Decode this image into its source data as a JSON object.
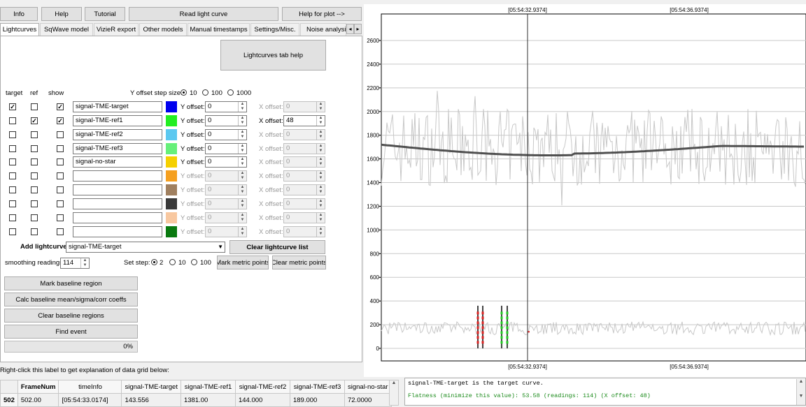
{
  "toolbar": {
    "info": "Info",
    "help": "Help",
    "tutorial": "Tutorial",
    "read_light_curve": "Read light curve",
    "help_for_plot": "Help for plot -->"
  },
  "tabs": [
    "Lightcurves",
    "SqWave model",
    "VizieR export",
    "Other models",
    "Manual timestamps",
    "Settings/Misc.",
    "Noise analysis/I"
  ],
  "tab_scroll_left": "◂",
  "tab_scroll_right": "▸",
  "lightcurves_help": "Lightcurves tab help",
  "headers": {
    "target": "target",
    "ref": "ref",
    "show": "show"
  },
  "y_offset_step": {
    "label": "Y offset step size:",
    "options": [
      "10",
      "100",
      "1000"
    ],
    "selected": "10"
  },
  "y_offset_label": "Y offset:",
  "x_offset_label": "X offset:",
  "curves": [
    {
      "target": true,
      "ref": false,
      "show": true,
      "name": "signal-TME-target",
      "color": "#0000ee",
      "y": "0",
      "x": "0",
      "x_enabled": false,
      "y_enabled": true
    },
    {
      "target": false,
      "ref": true,
      "show": true,
      "name": "signal-TME-ref1",
      "color": "#22ee22",
      "y": "0",
      "x": "48",
      "x_enabled": true,
      "y_enabled": true
    },
    {
      "target": false,
      "ref": false,
      "show": false,
      "name": "signal-TME-ref2",
      "color": "#5bc8f0",
      "y": "0",
      "x": "0",
      "x_enabled": false,
      "y_enabled": true
    },
    {
      "target": false,
      "ref": false,
      "show": false,
      "name": "signal-TME-ref3",
      "color": "#66f07a",
      "y": "0",
      "x": "0",
      "x_enabled": false,
      "y_enabled": true
    },
    {
      "target": false,
      "ref": false,
      "show": false,
      "name": "signal-no-star",
      "color": "#f5d000",
      "y": "0",
      "x": "0",
      "x_enabled": false,
      "y_enabled": true
    },
    {
      "target": false,
      "ref": false,
      "show": false,
      "name": "",
      "color": "#f5a020",
      "y": "0",
      "x": "0",
      "x_enabled": false,
      "y_enabled": false
    },
    {
      "target": false,
      "ref": false,
      "show": false,
      "name": "",
      "color": "#a08060",
      "y": "0",
      "x": "0",
      "x_enabled": false,
      "y_enabled": false
    },
    {
      "target": false,
      "ref": false,
      "show": false,
      "name": "",
      "color": "#3a3a3a",
      "y": "0",
      "x": "0",
      "x_enabled": false,
      "y_enabled": false
    },
    {
      "target": false,
      "ref": false,
      "show": false,
      "name": "",
      "color": "#f8c8a0",
      "y": "0",
      "x": "0",
      "x_enabled": false,
      "y_enabled": false
    },
    {
      "target": false,
      "ref": false,
      "show": false,
      "name": "",
      "color": "#0a7a10",
      "y": "0",
      "x": "0",
      "x_enabled": false,
      "y_enabled": false
    }
  ],
  "add_lightcurve": {
    "label": "Add lightcurve",
    "value": "signal-TME-target"
  },
  "clear_lightcurve_list": "Clear lightcurve list",
  "smoothing": {
    "label": "smoothing readings",
    "value": "114"
  },
  "set_step": {
    "label": "Set step:",
    "options": [
      "2",
      "10",
      "100"
    ],
    "selected": "2"
  },
  "mark_metric_points": "Mark metric points",
  "clear_metric_points": "Clear metric points",
  "mark_baseline_region": "Mark baseline region",
  "calc_baseline": "Calc baseline mean/sigma/corr coeffs",
  "clear_baseline_regions": "Clear baseline regions",
  "find_event": "Find event",
  "progress": {
    "text": "0%",
    "value": 0
  },
  "right_click_label": "Right-click this label to get explanation of data grid below:",
  "grid": {
    "columns": [
      "FrameNum",
      "timeInfo",
      "signal-TME-target",
      "signal-TME-ref1",
      "signal-TME-ref2",
      "signal-TME-ref3",
      "signal-no-star"
    ],
    "rows": [
      {
        "index": "502",
        "cells": [
          "502.00",
          "[05:54:33.0174]",
          "143.556",
          "1381.00",
          "144.000",
          "189.000",
          "72.0000"
        ]
      }
    ]
  },
  "output": {
    "line1": "signal-TME-target is the target curve.",
    "line2": "Flatness (minimize this value): 53.58 (readings: 114) (X offset: 48)"
  },
  "plot": {
    "top_time_labels": [
      "[05:54:32.9374]",
      "[05:54:36.9374]"
    ],
    "bottom_time_labels": [
      "[05:54:32.9374]",
      "[05:54:36.9374]"
    ],
    "y_ticks": [
      "2600",
      "2400",
      "2200",
      "2000",
      "1800",
      "1600",
      "1400",
      "1200",
      "1000",
      "800",
      "600",
      "400",
      "200",
      "0"
    ],
    "colors": {
      "ref_curve": "#c8c8c8",
      "smooth": "#505050",
      "target_curve": "#c8c8c8",
      "cursor": "#303030",
      "grid": "#c8c8c8"
    }
  }
}
